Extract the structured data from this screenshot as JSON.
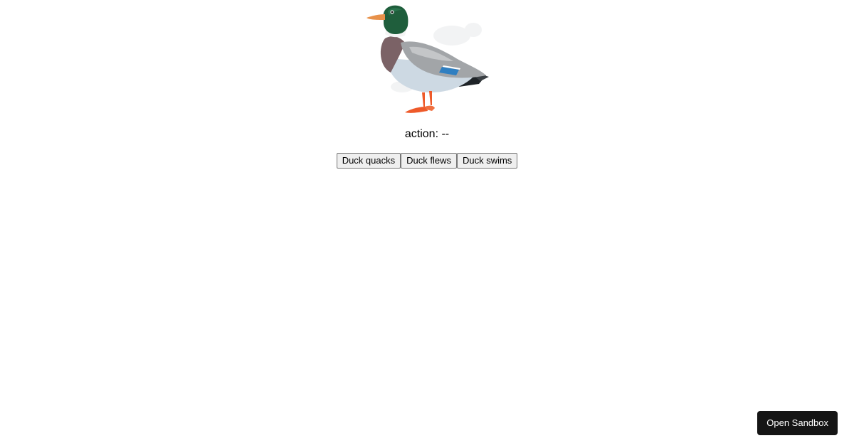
{
  "duck_image": {
    "description_icon": "mallard-duck-illustration"
  },
  "action": {
    "label": "action:",
    "value": "--"
  },
  "buttons": [
    {
      "label": "Duck quacks"
    },
    {
      "label": "Duck flews"
    },
    {
      "label": "Duck swims"
    }
  ],
  "sandbox": {
    "label": "Open Sandbox"
  },
  "colors": {
    "head_green": "#1f5e3c",
    "beak_orange": "#e8914a",
    "chest_brown": "#7b6266",
    "belly_pale": "#cdd9e3",
    "wing_gray": "#9c9ea0",
    "speculum_blue": "#2f7fc1",
    "feet_orange": "#ee5a2a",
    "sandbox_bg": "#151515"
  }
}
